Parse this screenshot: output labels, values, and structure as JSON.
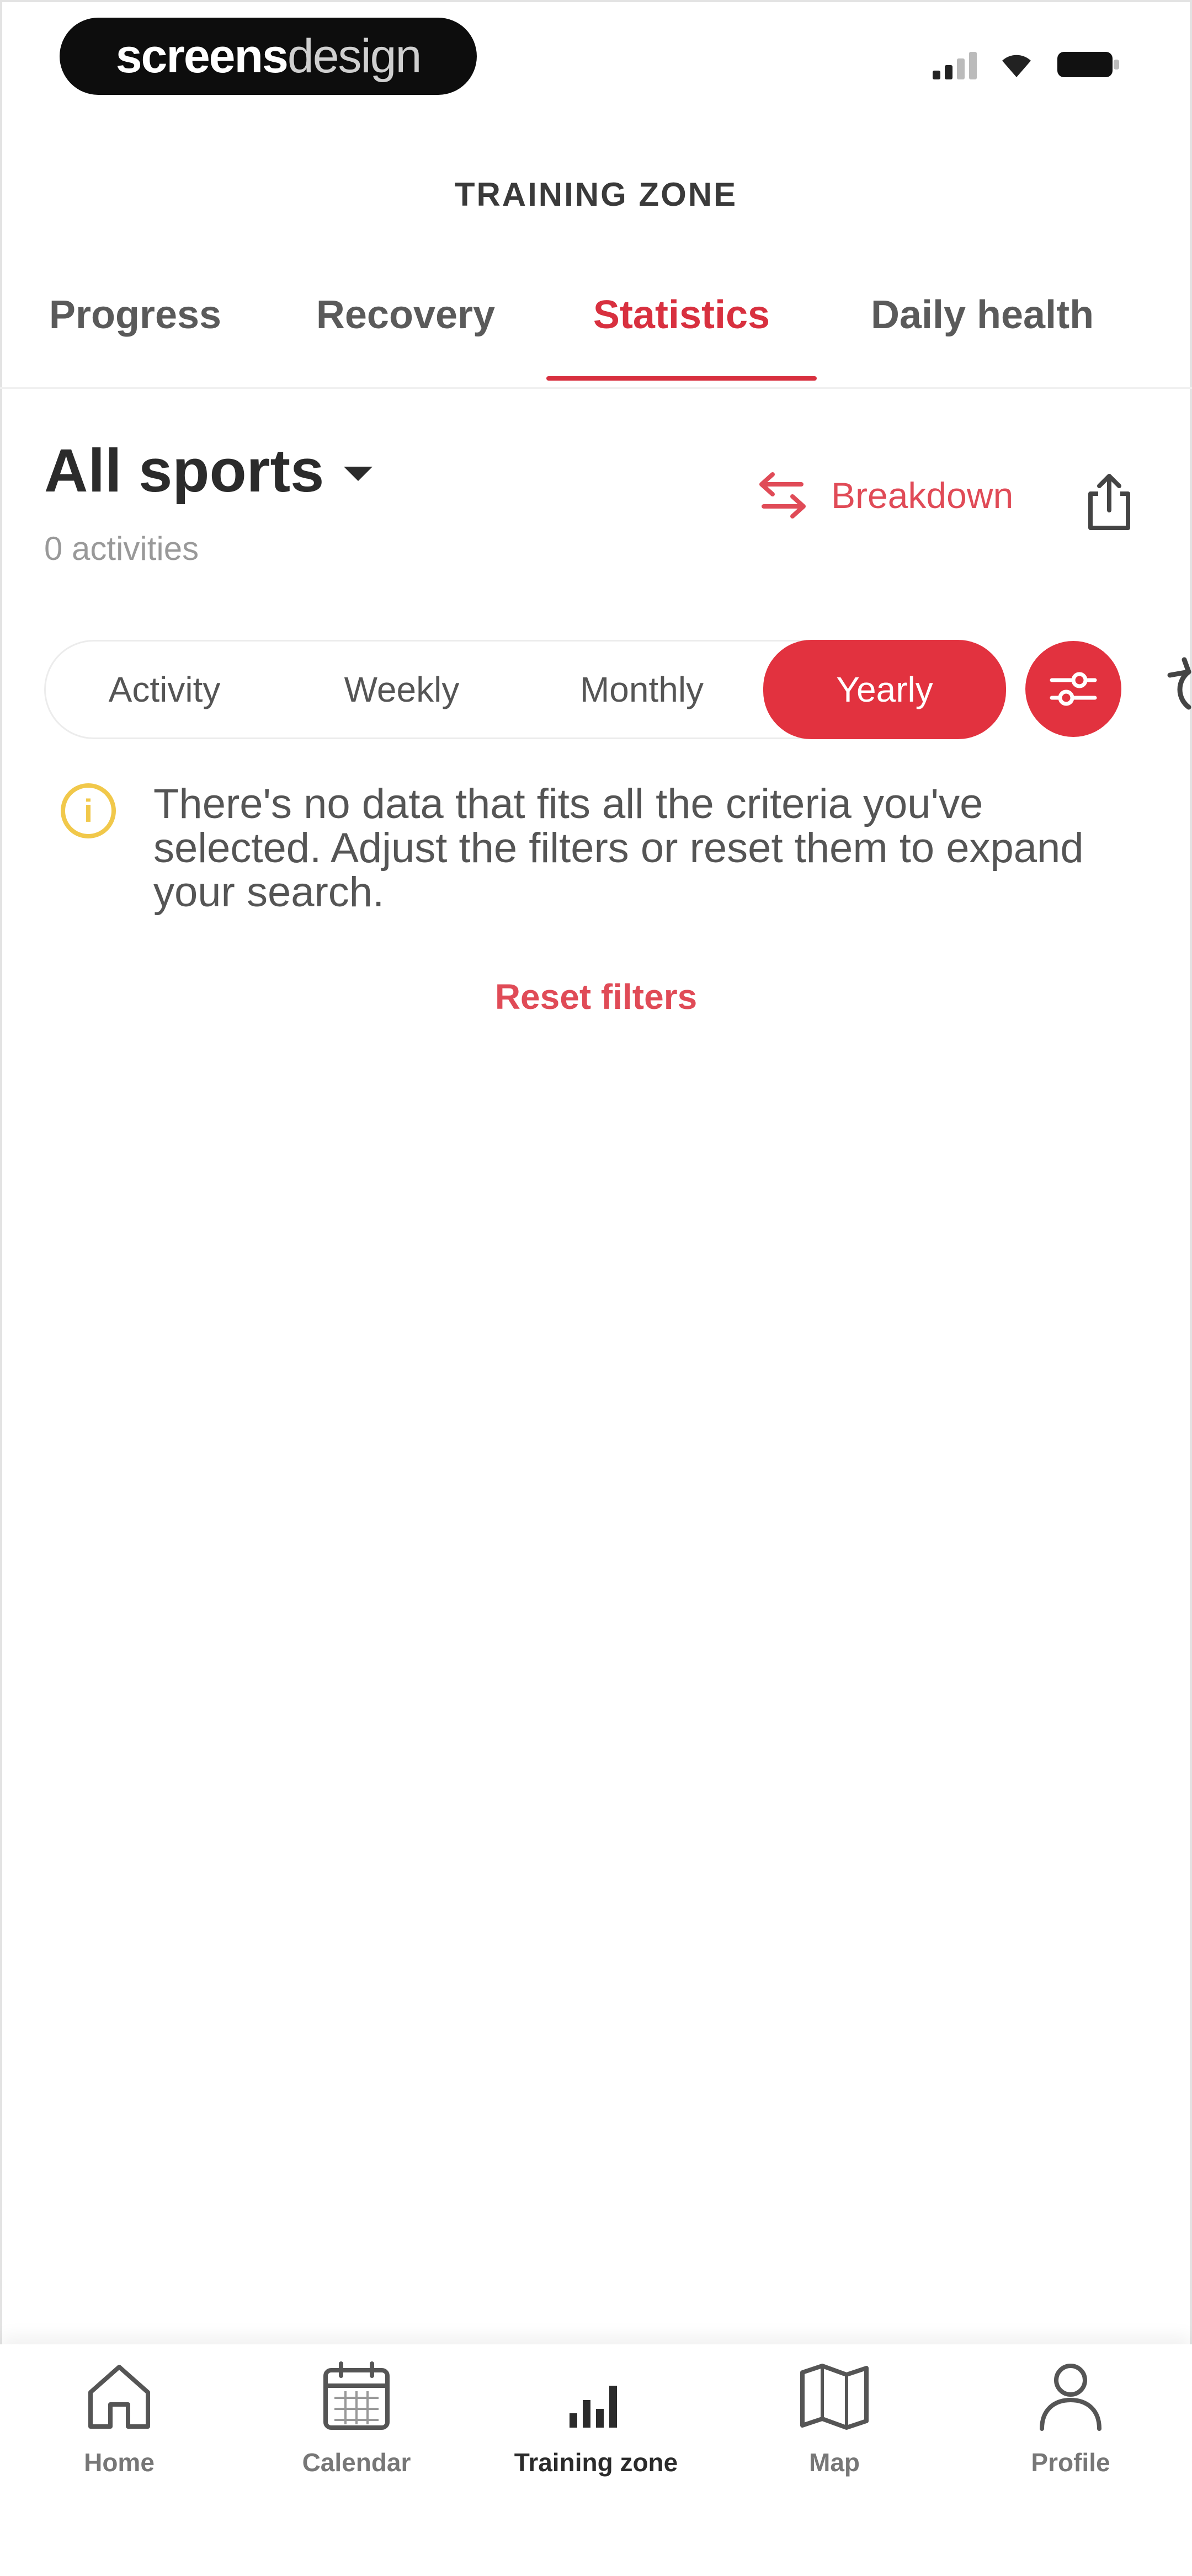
{
  "status_bar": {
    "brand_bold": "screens",
    "brand_light": "design",
    "icons": [
      "signal-icon",
      "wifi-icon",
      "battery-icon"
    ]
  },
  "header": {
    "title": "TRAINING ZONE"
  },
  "tabs": [
    {
      "label": "Progress",
      "active": false
    },
    {
      "label": "Recovery",
      "active": false
    },
    {
      "label": "Statistics",
      "active": true
    },
    {
      "label": "Daily health",
      "active": false
    }
  ],
  "sport": {
    "title": "All sports",
    "activity_count": "0 activities",
    "breakdown_label": "Breakdown"
  },
  "segments": {
    "items": [
      "Activity",
      "Weekly",
      "Monthly",
      "Yearly"
    ],
    "selected": "Yearly"
  },
  "empty_state": {
    "message": "There's no data that fits all the criteria you've selected. Adjust the filters or reset them to expand your search.",
    "reset_label": "Reset filters"
  },
  "bottom_nav": [
    {
      "label": "Home",
      "icon": "home-icon",
      "active": false
    },
    {
      "label": "Calendar",
      "icon": "calendar-icon",
      "active": false
    },
    {
      "label": "Training zone",
      "icon": "bar-chart-icon",
      "active": true
    },
    {
      "label": "Map",
      "icon": "map-icon",
      "active": false
    },
    {
      "label": "Profile",
      "icon": "profile-icon",
      "active": false
    }
  ],
  "colors": {
    "accent": "#e2323f",
    "accent_text": "#d8303f",
    "warning": "#f1c84a",
    "text_primary": "#2b2b2b",
    "text_secondary": "#999999"
  }
}
